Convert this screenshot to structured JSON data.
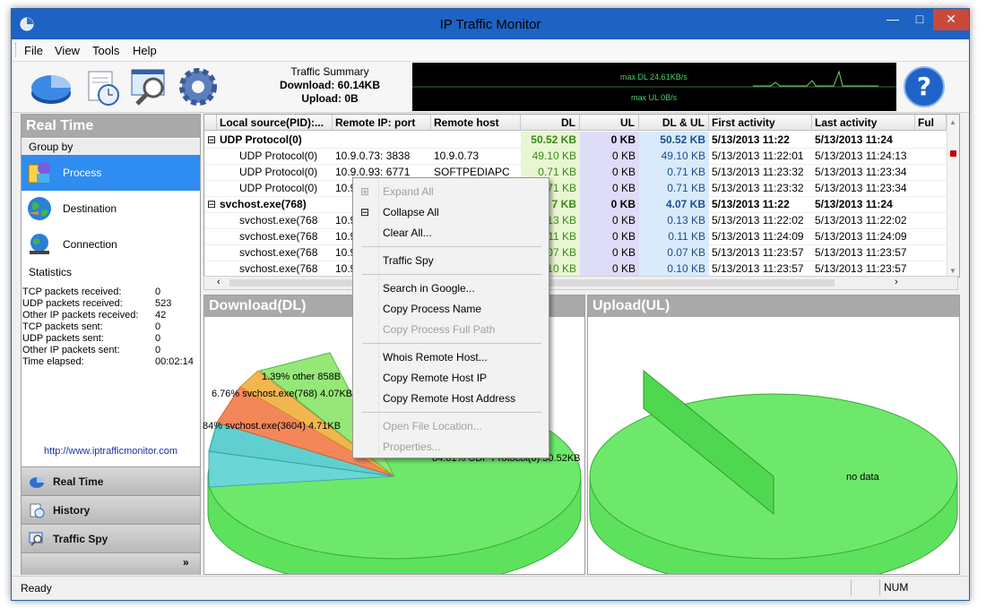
{
  "window": {
    "title": "IP Traffic Monitor",
    "accent": "#1e62c4"
  },
  "menu": [
    "File",
    "View",
    "Tools",
    "Help"
  ],
  "toolbar": {
    "summary_title": "Traffic Summary",
    "download": "Download: 60.14KB",
    "upload": "Upload: 0B",
    "graph_dl": "max DL 24.61KB/s",
    "graph_ul": "max UL 0B/s",
    "icons": [
      "pie-chart-icon",
      "history-clock-icon",
      "traffic-spy-icon",
      "settings-gear-icon",
      "help-icon"
    ]
  },
  "left": {
    "header": "Real Time",
    "group_by": "Group by",
    "groups": [
      {
        "label": "Process",
        "icon": "process-icon",
        "selected": true
      },
      {
        "label": "Destination",
        "icon": "globe-icon",
        "selected": false
      },
      {
        "label": "Connection",
        "icon": "connection-icon",
        "selected": false
      }
    ],
    "statistics_label": "Statistics",
    "stats": [
      {
        "k": "TCP packets received:",
        "v": "0"
      },
      {
        "k": "UDP packets received:",
        "v": "523"
      },
      {
        "k": "Other IP packets received:",
        "v": "42"
      },
      {
        "k": "TCP packets sent:",
        "v": "0"
      },
      {
        "k": "UDP packets sent:",
        "v": "0"
      },
      {
        "k": "Other IP packets sent:",
        "v": "0"
      },
      {
        "k": "Time elapsed:",
        "v": "00:02:14"
      }
    ],
    "url": "http://www.iptrafficmonitor.com",
    "nav": [
      {
        "label": "Real Time",
        "icon": "real-time-icon"
      },
      {
        "label": "History",
        "icon": "history-icon"
      },
      {
        "label": "Traffic Spy",
        "icon": "traffic-spy-nav-icon"
      }
    ]
  },
  "grid": {
    "headers": [
      "Local source(PID):...",
      "Remote IP: port",
      "Remote host",
      "DL",
      "UL",
      "DL & UL",
      "First activity",
      "Last activity",
      "Ful"
    ],
    "rows": [
      {
        "group": true,
        "c0": "UDP Protocol(0)",
        "c1": "",
        "c2": "",
        "dl": "50.52 KB",
        "ul": "0 KB",
        "dlul": "50.52 KB",
        "first": "5/13/2013 11:22",
        "last": "5/13/2013 11:24"
      },
      {
        "group": false,
        "c0": "UDP Protocol(0)",
        "c1": "10.9.0.73: 3838",
        "c2": "10.9.0.73",
        "dl": "49.10 KB",
        "ul": "0 KB",
        "dlul": "49.10 KB",
        "first": "5/13/2013 11:22:01",
        "last": "5/13/2013 11:24:13"
      },
      {
        "group": false,
        "c0": "UDP Protocol(0)",
        "c1": "10.9.0.93: 6771",
        "c2": "SOFTPEDIAPC",
        "dl": "0.71 KB",
        "ul": "0 KB",
        "dlul": "0.71 KB",
        "first": "5/13/2013 11:23:32",
        "last": "5/13/2013 11:23:34"
      },
      {
        "group": false,
        "c0": "UDP Protocol(0)",
        "c1": "10.9",
        "c2": "",
        "dl": "71 KB",
        "ul": "0 KB",
        "dlul": "0.71 KB",
        "first": "5/13/2013 11:23:32",
        "last": "5/13/2013 11:23:34"
      },
      {
        "group": true,
        "c0": "svchost.exe(768)",
        "c1": "",
        "c2": "",
        "dl": "7 KB",
        "ul": "0 KB",
        "dlul": "4.07 KB",
        "first": "5/13/2013 11:22",
        "last": "5/13/2013 11:24"
      },
      {
        "group": false,
        "c0": "svchost.exe(768",
        "c1": "10.9",
        "c2": "",
        "dl": "13 KB",
        "ul": "0 KB",
        "dlul": "0.13 KB",
        "first": "5/13/2013 11:22:02",
        "last": "5/13/2013 11:22:02"
      },
      {
        "group": false,
        "c0": "svchost.exe(768",
        "c1": "10.9",
        "c2": "",
        "dl": "11 KB",
        "ul": "0 KB",
        "dlul": "0.11 KB",
        "first": "5/13/2013 11:24:09",
        "last": "5/13/2013 11:24:09"
      },
      {
        "group": false,
        "c0": "svchost.exe(768",
        "c1": "10.9",
        "c2": "",
        "dl": "07 KB",
        "ul": "0 KB",
        "dlul": "0.07 KB",
        "first": "5/13/2013 11:23:57",
        "last": "5/13/2013 11:23:57"
      },
      {
        "group": false,
        "c0": "svchost.exe(768",
        "c1": "10.9",
        "c2": "",
        "dl": "10 KB",
        "ul": "0 KB",
        "dlul": "0.10 KB",
        "first": "5/13/2013 11:23:57",
        "last": "5/13/2013 11:23:57"
      }
    ]
  },
  "download_panel": {
    "header": "Download(DL)",
    "labels": [
      "1.39% other 858B",
      "6.76% svchost.exe(768) 4.07KB",
      "84% svchost.exe(3604) 4.71KB",
      "84.01% UDP Protocol(0) 50.52KB"
    ]
  },
  "upload_panel": {
    "header": "Upload(UL)",
    "no_data": "no data"
  },
  "context_menu": [
    {
      "label": "Expand All",
      "disabled": true,
      "icon": true
    },
    {
      "label": "Collapse All",
      "disabled": false,
      "icon": true
    },
    {
      "label": "Clear All...",
      "disabled": false
    },
    {
      "sep": true
    },
    {
      "label": "Traffic Spy",
      "disabled": false
    },
    {
      "sep": true
    },
    {
      "label": "Search in Google...",
      "disabled": false
    },
    {
      "label": "Copy Process Name",
      "disabled": false
    },
    {
      "label": "Copy Process Full Path",
      "disabled": true
    },
    {
      "sep": true
    },
    {
      "label": "Whois Remote Host...",
      "disabled": false
    },
    {
      "label": "Copy Remote Host IP",
      "disabled": false
    },
    {
      "label": "Copy Remote Host Address",
      "disabled": false
    },
    {
      "sep": true
    },
    {
      "label": "Open File Location...",
      "disabled": true
    },
    {
      "label": "Properties...",
      "disabled": true
    }
  ],
  "status": {
    "ready": "Ready",
    "num": "NUM"
  }
}
